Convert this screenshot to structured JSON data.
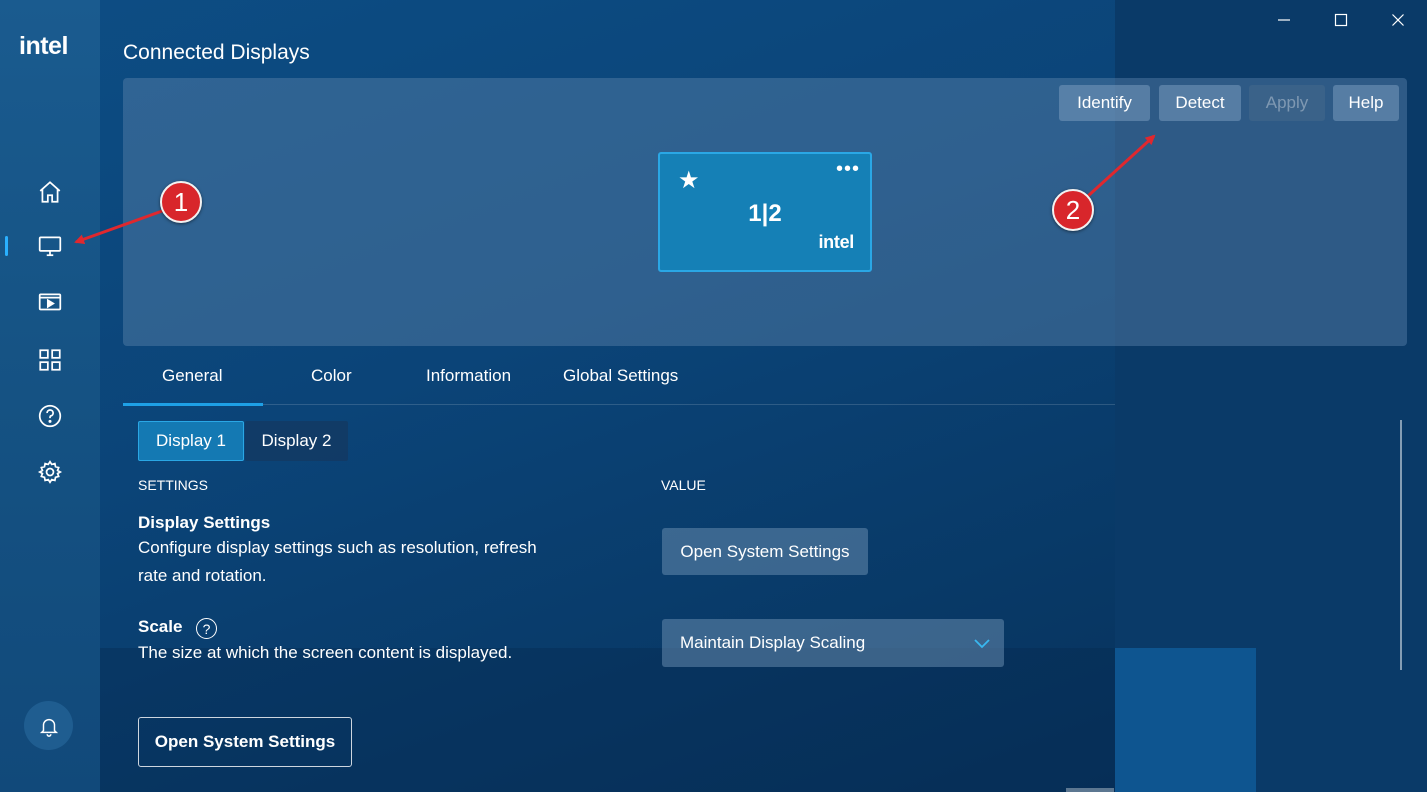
{
  "app": {
    "logo_text": "intel"
  },
  "window_controls": {
    "minimize": "minimize-icon",
    "maximize": "maximize-icon",
    "close": "close-icon"
  },
  "sidebar": {
    "items": [
      {
        "icon": "home-icon",
        "active": false
      },
      {
        "icon": "monitor-icon",
        "active": true
      },
      {
        "icon": "video-icon",
        "active": false
      },
      {
        "icon": "apps-grid-icon",
        "active": false
      },
      {
        "icon": "help-icon",
        "active": false
      },
      {
        "icon": "gear-icon",
        "active": false
      }
    ],
    "bottom_icon": "bell-icon"
  },
  "page": {
    "title": "Connected Displays"
  },
  "toolbar": {
    "identify": "Identify",
    "detect": "Detect",
    "apply": "Apply",
    "help": "Help"
  },
  "display_card": {
    "label": "1|2",
    "brand": "intel",
    "star": "★",
    "menu": "•••"
  },
  "annotations": {
    "first": "1",
    "second": "2"
  },
  "tabs": [
    {
      "label": "General",
      "active": true
    },
    {
      "label": "Color",
      "active": false
    },
    {
      "label": "Information",
      "active": false
    },
    {
      "label": "Global Settings",
      "active": false
    }
  ],
  "display_tabs": [
    {
      "label": "Display 1",
      "active": true
    },
    {
      "label": "Display 2",
      "active": false
    }
  ],
  "columns": {
    "settings": "SETTINGS",
    "value": "VALUE"
  },
  "settings": {
    "display": {
      "title": "Display Settings",
      "desc_line1": "Configure display settings such as resolution, refresh",
      "desc_line2": "rate and rotation.",
      "button": "Open System Settings"
    },
    "scale": {
      "title": "Scale",
      "help": "?",
      "desc": "The size at which the screen content is displayed.",
      "selected": "Maintain Display Scaling"
    }
  },
  "footer_button": "Open System Settings",
  "colors": {
    "accent": "#1ea0e6",
    "annotation": "#d8262b",
    "card": "#1580b6"
  }
}
